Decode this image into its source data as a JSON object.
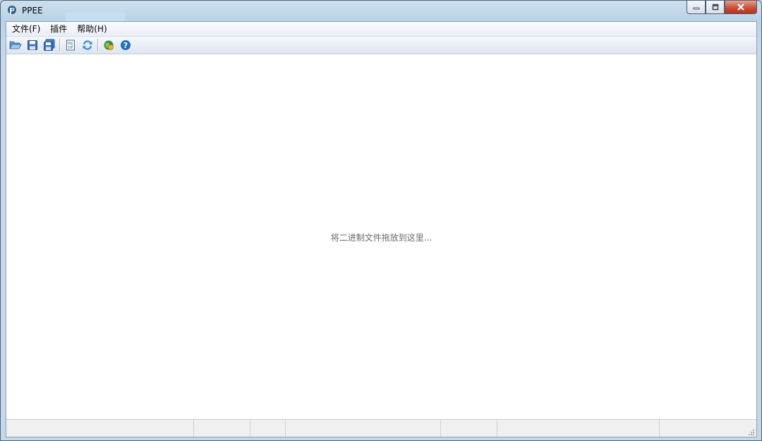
{
  "window": {
    "title": "PPEE"
  },
  "menu": {
    "items": [
      "文件(F)",
      "插件",
      "帮助(H)"
    ]
  },
  "toolbar": {
    "buttons": [
      "open-icon",
      "save-icon",
      "save-all-icon",
      "hex-view-icon",
      "refresh-icon",
      "plugin-icon",
      "help-icon"
    ],
    "help_glyph": "?"
  },
  "content": {
    "drop_hint": "将二进制文件拖放到这里..."
  },
  "statusbar": {
    "panes": [
      "",
      "",
      "",
      "",
      "",
      "",
      "",
      ""
    ]
  }
}
